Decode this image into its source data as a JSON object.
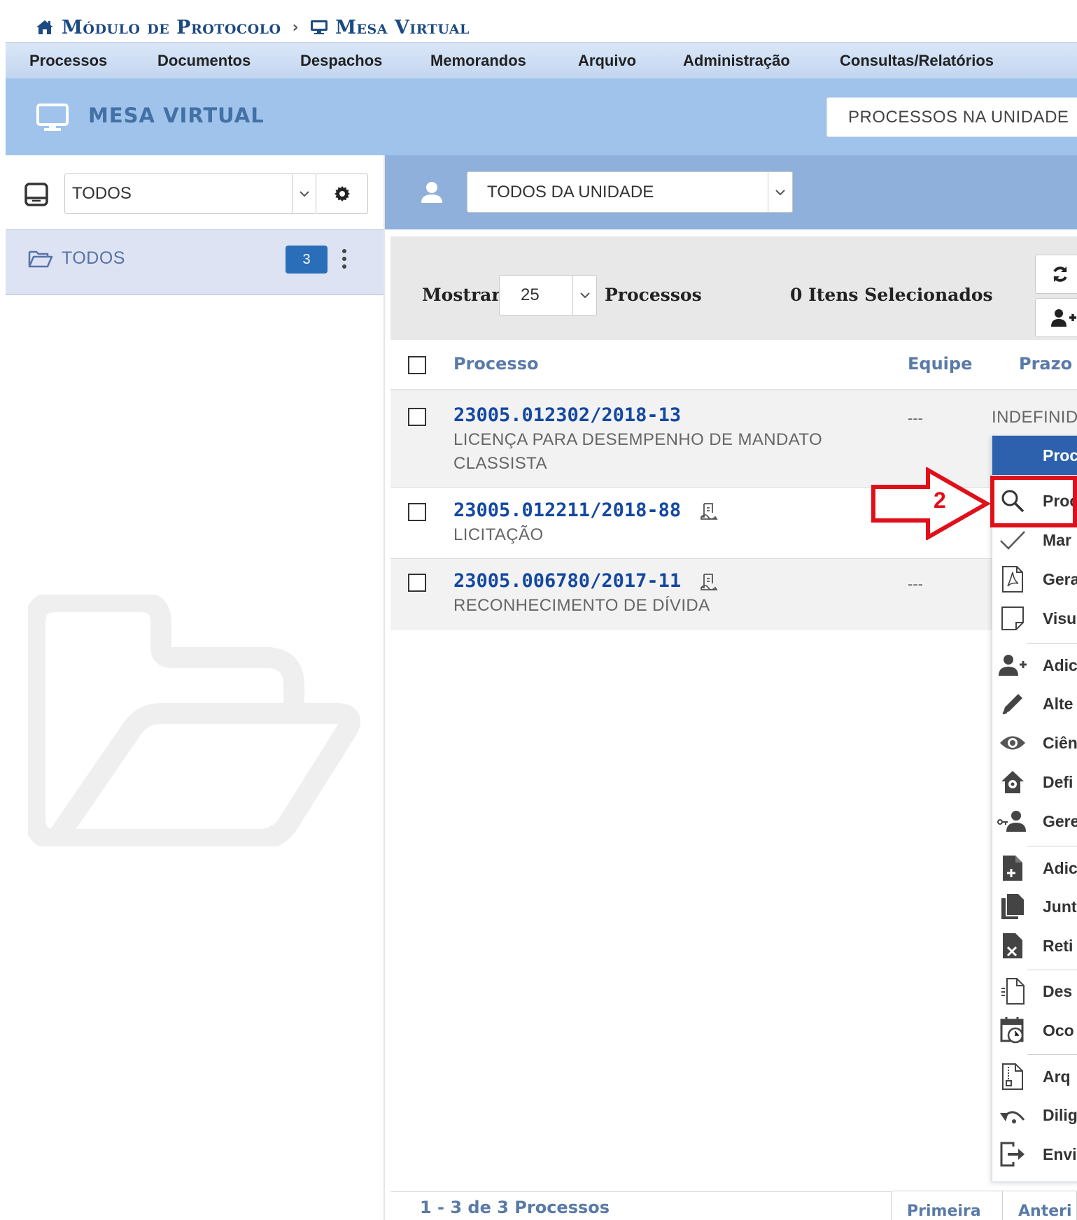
{
  "breadcrumb": {
    "module": "Módulo de Protocolo",
    "separator": "›",
    "current": "Mesa Virtual"
  },
  "menu": [
    "Processos",
    "Documentos",
    "Despachos",
    "Memorandos",
    "Arquivo",
    "Administração",
    "Consultas/Relatórios"
  ],
  "header": {
    "title": "MESA VIRTUAL",
    "processes_button": "PROCESSOS NA UNIDADE"
  },
  "left": {
    "filter_value": "TODOS",
    "folder": {
      "label": "TODOS",
      "count": "3"
    }
  },
  "user_filter": {
    "value": "TODOS DA UNIDADE"
  },
  "toolbar": {
    "show_label": "Mostrar",
    "page_size": "25",
    "processes_label": "Processos",
    "selected_label": "0 Itens Selecionados"
  },
  "table": {
    "columns": [
      "Processo",
      "Equipe",
      "Prazo"
    ],
    "rows": [
      {
        "number": "23005.012302/2018-13",
        "description": "LICENÇA PARA DESEMPENHO DE MANDATO CLASSISTA",
        "team": "---",
        "deadline": "INDEFINID",
        "has_signer_icon": false
      },
      {
        "number": "23005.012211/2018-88",
        "description": "LICITAÇÃO",
        "team": "",
        "deadline": "",
        "has_signer_icon": true
      },
      {
        "number": "23005.006780/2017-11",
        "description": "RECONHECIMENTO DE DÍVIDA",
        "team": "---",
        "deadline": "",
        "has_signer_icon": true
      }
    ]
  },
  "context_menu": {
    "header": "Proc",
    "items": [
      {
        "label": "Proc",
        "icon": "search-icon"
      },
      {
        "label": "Mar",
        "icon": "check-icon"
      },
      {
        "label": "Gera",
        "icon": "pdf-icon"
      },
      {
        "label": "Visu",
        "icon": "page-icon"
      },
      {
        "label": "Adic",
        "icon": "add-user-icon"
      },
      {
        "label": "Alte",
        "icon": "pencil-icon"
      },
      {
        "label": "Ciên",
        "icon": "eye-icon"
      },
      {
        "label": "Defi",
        "icon": "home-pin-icon"
      },
      {
        "label": "Gere",
        "icon": "key-user-icon"
      },
      {
        "label": "Adic",
        "icon": "file-plus-icon"
      },
      {
        "label": "Junt",
        "icon": "files-icon"
      },
      {
        "label": "Reti",
        "icon": "file-remove-icon"
      },
      {
        "label": "Des",
        "icon": "file-split-icon"
      },
      {
        "label": "Oco",
        "icon": "calendar-clock-icon"
      },
      {
        "label": "Arq",
        "icon": "archive-file-icon"
      },
      {
        "label": "Dilig",
        "icon": "undo-icon"
      },
      {
        "label": "Envi",
        "icon": "exit-icon"
      }
    ]
  },
  "annotation": {
    "number": "2",
    "color": "#e0101a"
  },
  "footer": {
    "range": "1 - 3 de 3 Processos",
    "first": "Primeira",
    "previous": "Anteri"
  },
  "colors": {
    "accent": "#2d61ad",
    "header_band": "#9fc3eb",
    "link": "#1448a0"
  }
}
